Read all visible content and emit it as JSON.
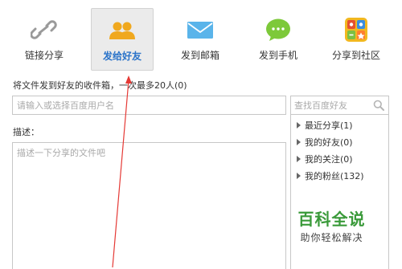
{
  "tabs": [
    {
      "label": "链接分享",
      "icon": "link-icon",
      "active": false
    },
    {
      "label": "发给好友",
      "icon": "friends-icon",
      "active": true
    },
    {
      "label": "发到邮箱",
      "icon": "mail-icon",
      "active": false
    },
    {
      "label": "发到手机",
      "icon": "chat-bubble-icon",
      "active": false
    },
    {
      "label": "分享到社区",
      "icon": "community-icon",
      "active": false
    }
  ],
  "send": {
    "hint": "将文件发到好友的收件箱，一次最多20人(0)",
    "recipient_placeholder": "请输入或选择百度用户名",
    "description_label": "描述：",
    "description_placeholder": "描述一下分享的文件吧"
  },
  "friend_search": {
    "placeholder": "查找百度好友"
  },
  "friend_groups": [
    {
      "label": "最近分享(1)"
    },
    {
      "label": "我的好友(0)"
    },
    {
      "label": "我的关注(0)"
    },
    {
      "label": "我的粉丝(132)"
    }
  ],
  "watermark": {
    "title": "百科全说",
    "subtitle": "助你轻松解决"
  },
  "colors": {
    "accent": "#2a73c9",
    "annotation_arrow": "#e53935",
    "watermark_green": "#3a9a3a"
  }
}
